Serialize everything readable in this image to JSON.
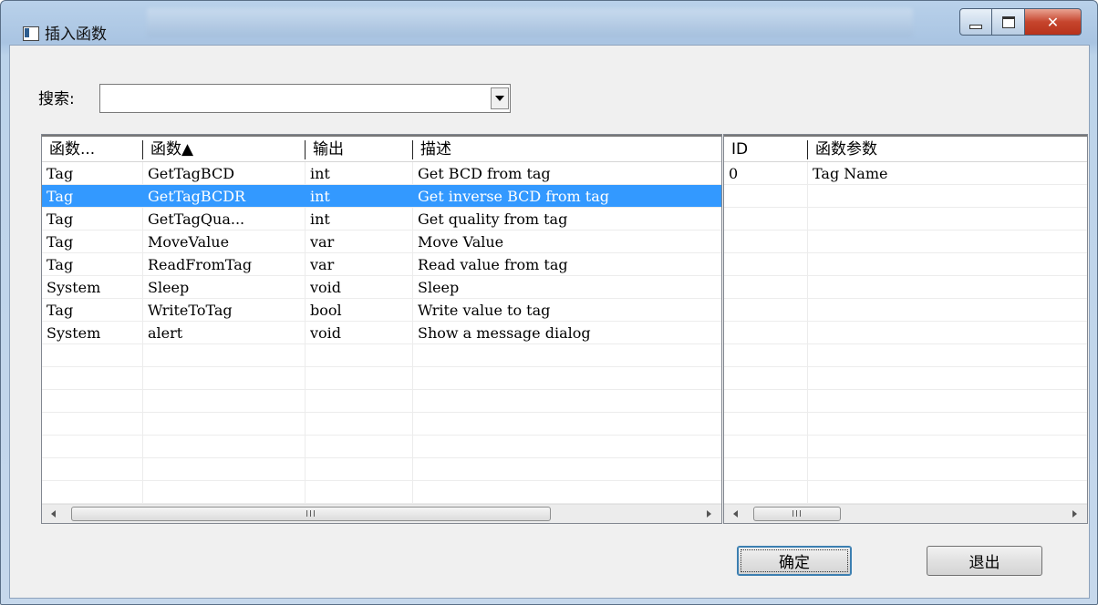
{
  "window": {
    "title": "插入函数"
  },
  "search": {
    "label": "搜索:",
    "value": "",
    "placeholder": ""
  },
  "functions_table": {
    "columns": [
      "函数...",
      "函数▲",
      "输出",
      "描述"
    ],
    "selected_index": 1,
    "rows": [
      {
        "category": "Tag",
        "name": "GetTagBCD",
        "output": "int",
        "description": "Get BCD from tag"
      },
      {
        "category": "Tag",
        "name": "GetTagBCDR",
        "output": "int",
        "description": "Get inverse BCD from tag"
      },
      {
        "category": "Tag",
        "name": "GetTagQua...",
        "output": "int",
        "description": "Get quality from tag"
      },
      {
        "category": "Tag",
        "name": "MoveValue",
        "output": "var",
        "description": "Move Value"
      },
      {
        "category": "Tag",
        "name": "ReadFromTag",
        "output": "var",
        "description": "Read value from tag"
      },
      {
        "category": "System",
        "name": "Sleep",
        "output": "void",
        "description": "Sleep"
      },
      {
        "category": "Tag",
        "name": "WriteToTag",
        "output": "bool",
        "description": "Write value to tag"
      },
      {
        "category": "System",
        "name": "alert",
        "output": "void",
        "description": "Show a message dialog"
      }
    ]
  },
  "params_table": {
    "columns": [
      "ID",
      "函数参数"
    ],
    "rows": [
      {
        "id": "0",
        "param": "Tag Name"
      }
    ]
  },
  "scroll_grip": "III",
  "buttons": {
    "ok": "确定",
    "exit": "退出"
  },
  "colors": {
    "selection": "#3399ff",
    "close_button": "#c6452d"
  }
}
